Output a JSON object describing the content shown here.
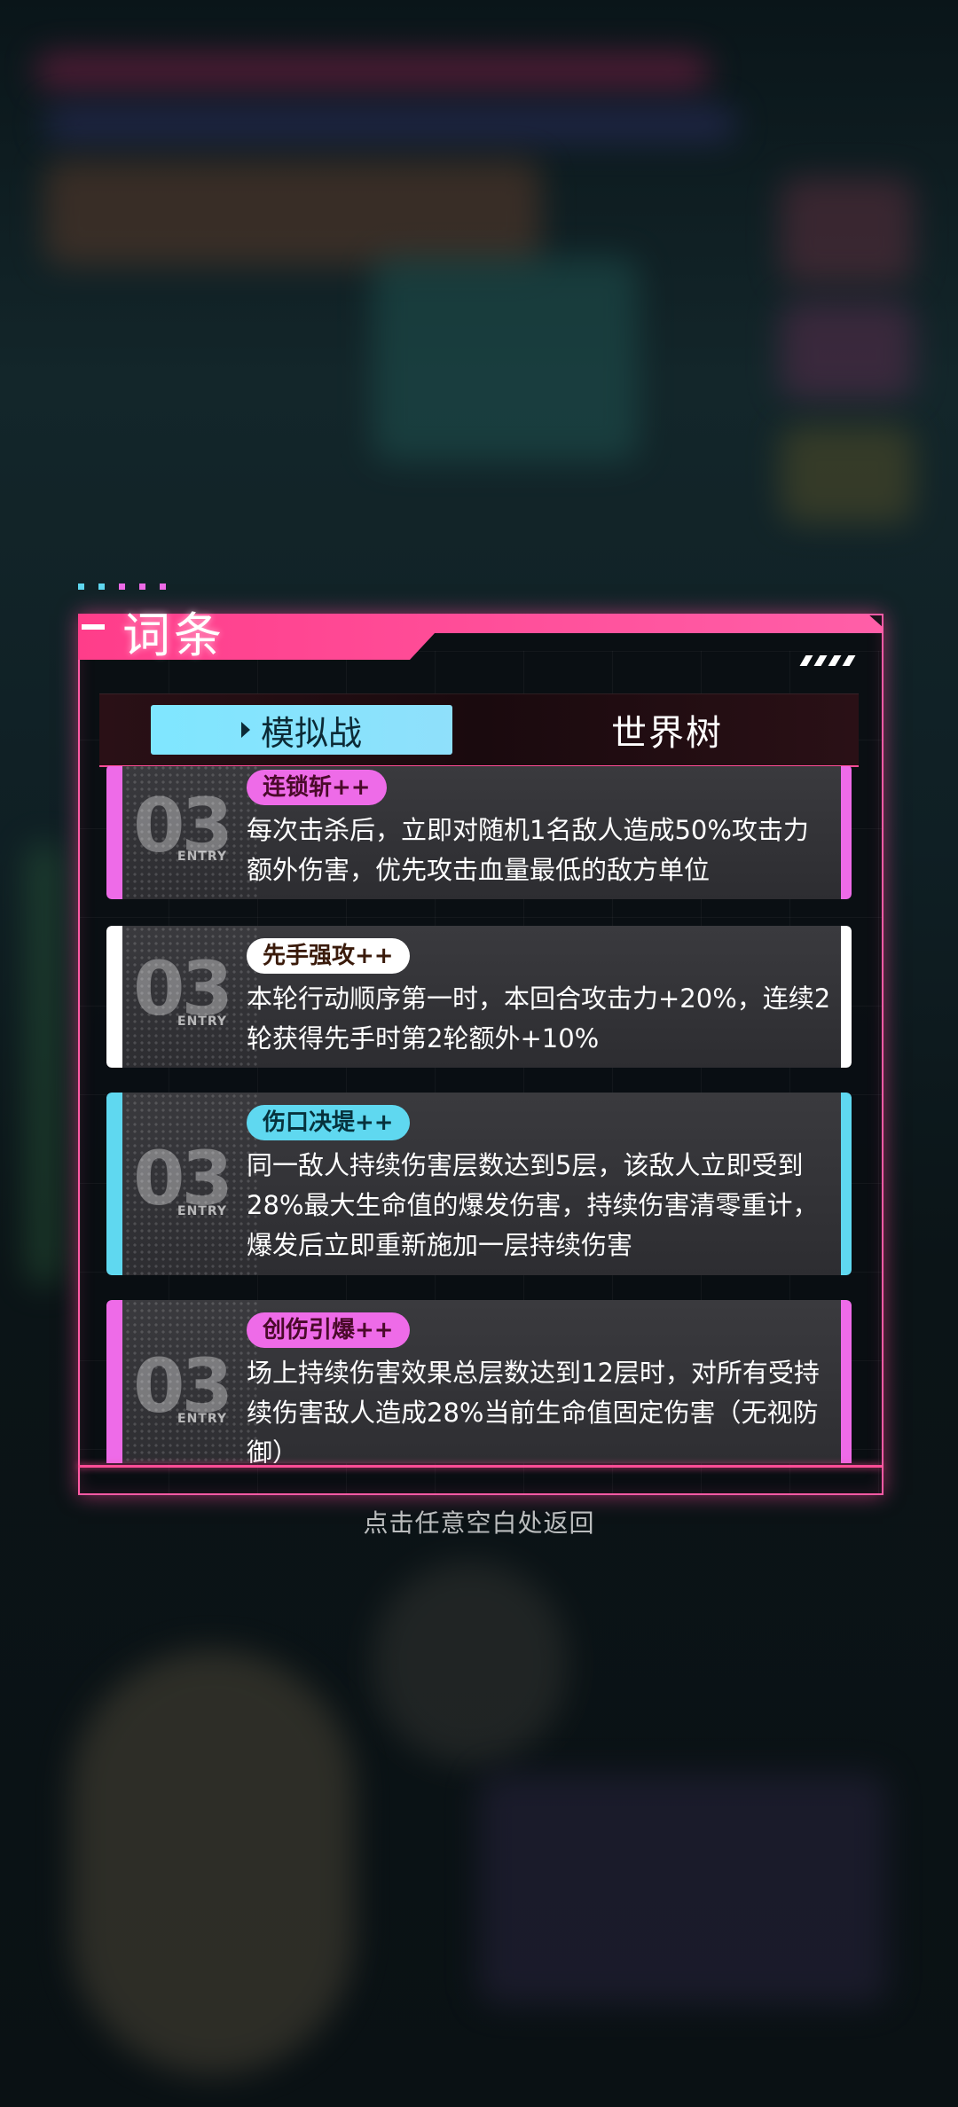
{
  "dialog": {
    "title": "词条",
    "accent_color": "#ff4d96"
  },
  "tabs": [
    {
      "label": "模拟战",
      "active": true
    },
    {
      "label": "世界树",
      "active": false
    }
  ],
  "entries": [
    {
      "number": "03",
      "entry_label": "ENTRY",
      "name": "连锁斩++",
      "color": "#ee6be8",
      "description": "每次击杀后，立即对随机1名敌人造成50%攻击力额外伤害，优先攻击血量最低的敌方单位"
    },
    {
      "number": "03",
      "entry_label": "ENTRY",
      "name": "先手强攻++",
      "color": "#ffffff",
      "description": "本轮行动顺序第一时，本回合攻击力+20%，连续2轮获得先手时第2轮额外+10%"
    },
    {
      "number": "03",
      "entry_label": "ENTRY",
      "name": "伤口决堤++",
      "color": "#5fd8f0",
      "description": "同一敌人持续伤害层数达到5层，该敌人立即受到28%最大生命值的爆发伤害，持续伤害清零重计，爆发后立即重新施加一层持续伤害"
    },
    {
      "number": "03",
      "entry_label": "ENTRY",
      "name": "创伤引爆++",
      "color": "#ee6be8",
      "description": "场上持续伤害效果总层数达到12层时，对所有受持续伤害敌人造成28%当前生命值固定伤害（无视防御）"
    }
  ],
  "hint": "点击任意空白处返回"
}
